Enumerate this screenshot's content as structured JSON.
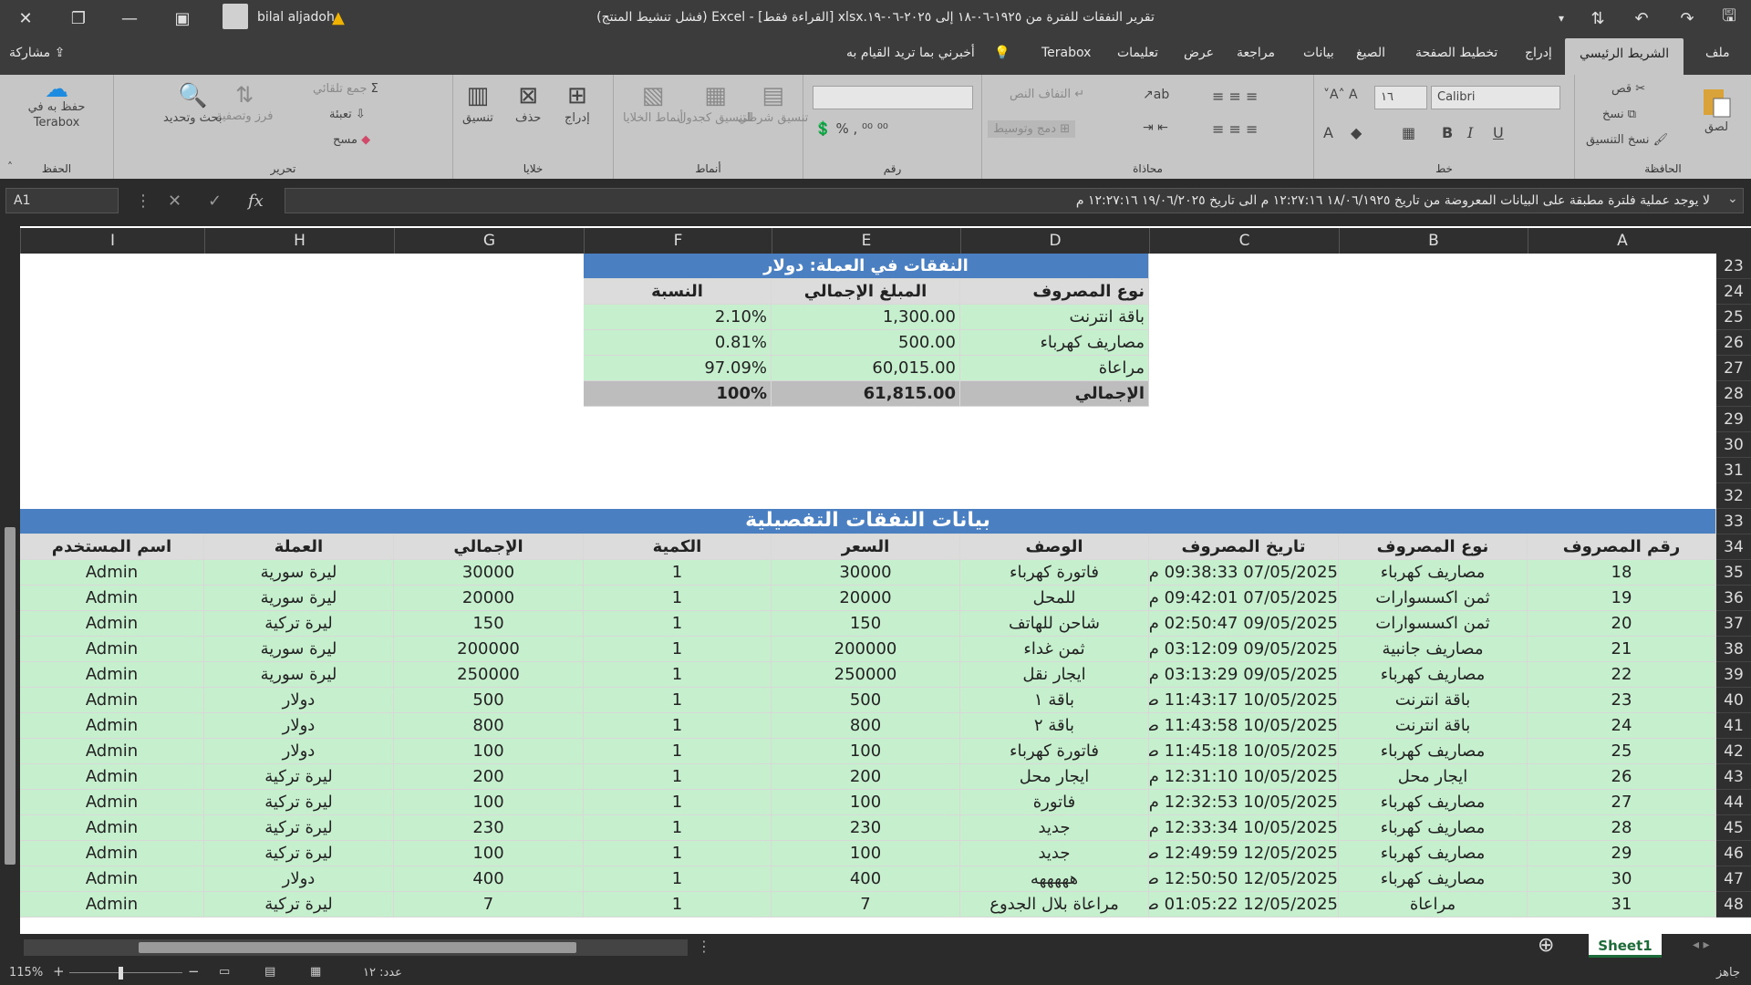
{
  "app": {
    "title": "تقرير النفقات للفترة من ١٩٢٥-٠٦-١٨ إلى ٢٠٢٥-٠٦-١٩.xlsx [القراءة فقط] - Excel (فشل تنشيط المنتج)",
    "user_name": "bilal aljadoh",
    "share_label": "مشاركة"
  },
  "tabs": [
    "ملف",
    "الشريط الرئيسي",
    "إدراج",
    "تخطيط الصفحة",
    "الصيغ",
    "بيانات",
    "مراجعة",
    "عرض",
    "تعليمات",
    "Terabox",
    "أخبرني بما تريد القيام به"
  ],
  "ribbon": {
    "clipboard": {
      "label": "الحافظة",
      "paste": "لصق",
      "cut": "قص",
      "copy": "نسخ",
      "format_painter": "نسخ التنسيق"
    },
    "font": {
      "label": "خط",
      "name": "Calibri",
      "size": "١٦"
    },
    "alignment": {
      "label": "محاذاة",
      "wrap": "التفاف النص",
      "merge": "دمج وتوسيط"
    },
    "number": {
      "label": "رقم"
    },
    "styles": {
      "label": "أنماط",
      "conditional": "تنسيق شرطي",
      "table": "التنسيق كجدول",
      "cell_styles": "أنماط الخلايا"
    },
    "cells": {
      "label": "خلايا",
      "insert": "إدراج",
      "delete": "حذف",
      "format": "تنسيق"
    },
    "editing": {
      "label": "تحرير",
      "autosum": "جمع تلقائي",
      "fill": "تعبئة",
      "clear": "مسح",
      "sort": "فرز وتصفية",
      "find": "بحث وتحديد"
    },
    "save": {
      "label": "الحفظ",
      "terabox": "حفظ به في Terabox"
    }
  },
  "formula_bar": {
    "name_box": "A1",
    "content": "لا يوجد عملية فلترة مطبقة على البيانات المعروضة من تاريخ ١٨/٠٦/١٩٢٥ ١٢:٢٧:١٦ م الى تاريخ ١٩/٠٦/٢٠٢٥ ١٢:٢٧:١٦ م"
  },
  "columns": [
    "A",
    "B",
    "C",
    "D",
    "E",
    "F",
    "G",
    "H",
    "I"
  ],
  "summary": {
    "title": "النفقات في العملة: دولار",
    "headers": [
      "نوع المصروف",
      "المبلغ الإجمالي",
      "النسبة"
    ],
    "rows": [
      [
        "باقة انترنت",
        "1,300.00",
        "2.10%"
      ],
      [
        "مصاريف كهرباء",
        "500.00",
        "0.81%"
      ],
      [
        "مراعاة",
        "60,015.00",
        "97.09%"
      ]
    ],
    "total": [
      "الإجمالي",
      "61,815.00",
      "100%"
    ]
  },
  "details": {
    "title": "بيانات النفقات التفصيلية",
    "headers": [
      "رقم المصروف",
      "نوع المصروف",
      "تاريخ المصروف",
      "الوصف",
      "السعر",
      "الكمية",
      "الإجمالي",
      "العملة",
      "اسم المستخدم"
    ],
    "rows": [
      [
        "18",
        "مصاريف كهرباء",
        "07/05/2025 09:38:33 م",
        "فاتورة كهرباء",
        "30000",
        "1",
        "30000",
        "ليرة سورية",
        "Admin"
      ],
      [
        "19",
        "ثمن اكسسوارات",
        "07/05/2025 09:42:01 م",
        "للمحل",
        "20000",
        "1",
        "20000",
        "ليرة سورية",
        "Admin"
      ],
      [
        "20",
        "ثمن اكسسوارات",
        "09/05/2025 02:50:47 م",
        "شاحن للهاتف",
        "150",
        "1",
        "150",
        "ليرة تركية",
        "Admin"
      ],
      [
        "21",
        "مصاريف جانبية",
        "09/05/2025 03:12:09 م",
        "ثمن غداء",
        "200000",
        "1",
        "200000",
        "ليرة سورية",
        "Admin"
      ],
      [
        "22",
        "مصاريف كهرباء",
        "09/05/2025 03:13:29 م",
        "ايجار نقل",
        "250000",
        "1",
        "250000",
        "ليرة سورية",
        "Admin"
      ],
      [
        "23",
        "باقة انترنت",
        "10/05/2025 11:43:17 ص",
        "باقة ١",
        "500",
        "1",
        "500",
        "دولار",
        "Admin"
      ],
      [
        "24",
        "باقة انترنت",
        "10/05/2025 11:43:58 ص",
        "باقة ٢",
        "800",
        "1",
        "800",
        "دولار",
        "Admin"
      ],
      [
        "25",
        "مصاريف كهرباء",
        "10/05/2025 11:45:18 ص",
        "فاتورة كهرباء",
        "100",
        "1",
        "100",
        "دولار",
        "Admin"
      ],
      [
        "26",
        "ايجار محل",
        "10/05/2025 12:31:10 م",
        "ايجار محل",
        "200",
        "1",
        "200",
        "ليرة تركية",
        "Admin"
      ],
      [
        "27",
        "مصاريف كهرباء",
        "10/05/2025 12:32:53 م",
        "فاتورة",
        "100",
        "1",
        "100",
        "ليرة تركية",
        "Admin"
      ],
      [
        "28",
        "مصاريف كهرباء",
        "10/05/2025 12:33:34 م",
        "جديد",
        "230",
        "1",
        "230",
        "ليرة تركية",
        "Admin"
      ],
      [
        "29",
        "مصاريف كهرباء",
        "12/05/2025 12:49:59 ص",
        "جديد",
        "100",
        "1",
        "100",
        "ليرة تركية",
        "Admin"
      ],
      [
        "30",
        "مصاريف كهرباء",
        "12/05/2025 12:50:50 ص",
        "هههههه",
        "400",
        "1",
        "400",
        "دولار",
        "Admin"
      ],
      [
        "31",
        "مراعاة",
        "12/05/2025 01:05:22 ص",
        "مراعاة بلال الجدوع",
        "7",
        "1",
        "7",
        "ليرة تركية",
        "Admin"
      ]
    ]
  },
  "row_numbers": [
    "23",
    "24",
    "25",
    "26",
    "27",
    "28",
    "29",
    "30",
    "31",
    "32",
    "33",
    "34",
    "35",
    "36",
    "37",
    "38",
    "39",
    "40",
    "41",
    "42",
    "43",
    "44",
    "45",
    "46",
    "47",
    "48"
  ],
  "sheet": {
    "name": "Sheet1"
  },
  "status": {
    "ready": "جاهز",
    "count": "عدد: ١٢",
    "zoom": "115%"
  }
}
